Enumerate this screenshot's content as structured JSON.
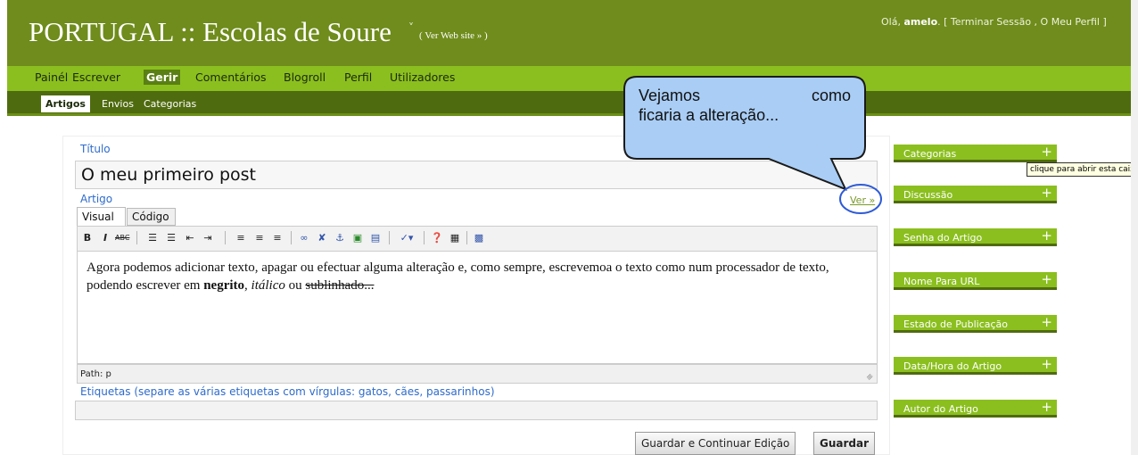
{
  "header": {
    "site_title": "PORTUGAL :: Escolas de Soure",
    "view_site": "( Ver Web site » )",
    "greeting": "Olá, ",
    "username": "amelo",
    "user_links": ". [ Terminar Sessão ,  O Meu Perfil ]"
  },
  "main_nav": [
    "Painél",
    "Escrever",
    "Gerir",
    "Comentários",
    "Blogroll",
    "Perfil",
    "Utilizadores"
  ],
  "sub_nav": [
    "Artigos",
    "Envios",
    "Categorias"
  ],
  "post": {
    "title_label": "Título",
    "title_value": "O meu primeiro post",
    "article_label": "Artigo",
    "preview_link": "Ver »",
    "tab_visual": "Visual",
    "tab_code": "Código",
    "body_text": "Agora podemos adicionar texto, apagar ou efectuar alguma alteração e, como sempre, escrevemoa o texto como num processador de texto, podendo escrever em ",
    "bold_text": "negrito",
    "comma": ", ",
    "italic_text": "itálico",
    "or_text": " ou ",
    "strike_text": "sublinhado...",
    "path_text": "Path: p",
    "tags_label": "Etiquetas (separe as várias etiquetas com vírgulas: gatos, cães, passarinhos)",
    "tags_value": ""
  },
  "toolbar_icons": [
    "bold-icon",
    "italic-icon",
    "strikethrough-icon",
    "bullet-list-icon",
    "numbered-list-icon",
    "outdent-icon",
    "indent-icon",
    "align-left-icon",
    "align-center-icon",
    "align-right-icon",
    "link-icon",
    "unlink-icon",
    "anchor-icon",
    "image-icon",
    "more-break-icon",
    "spellcheck-icon",
    "help-icon",
    "toolbar-toggle-icon",
    "fullscreen-icon"
  ],
  "buttons": {
    "save_continue": "Guardar e Continuar Edição",
    "save": "Guardar"
  },
  "sidebar": [
    "Categorias",
    "Discussão",
    "Senha do Artigo",
    "Nome Para URL",
    "Estado de Publicação",
    "Data/Hora do Artigo",
    "Autor do Artigo"
  ],
  "tooltip": "clique para abrir esta caixa",
  "callout": {
    "line1_a": "Vejamos",
    "line1_b": "como",
    "line2": "ficaria a alteração..."
  },
  "colors": {
    "header": "#6f8c1c",
    "nav": "#8bbf1f",
    "subnav": "#4f6b0f",
    "link_blue": "#2e6bcb",
    "callout": "#a9cdf5"
  }
}
